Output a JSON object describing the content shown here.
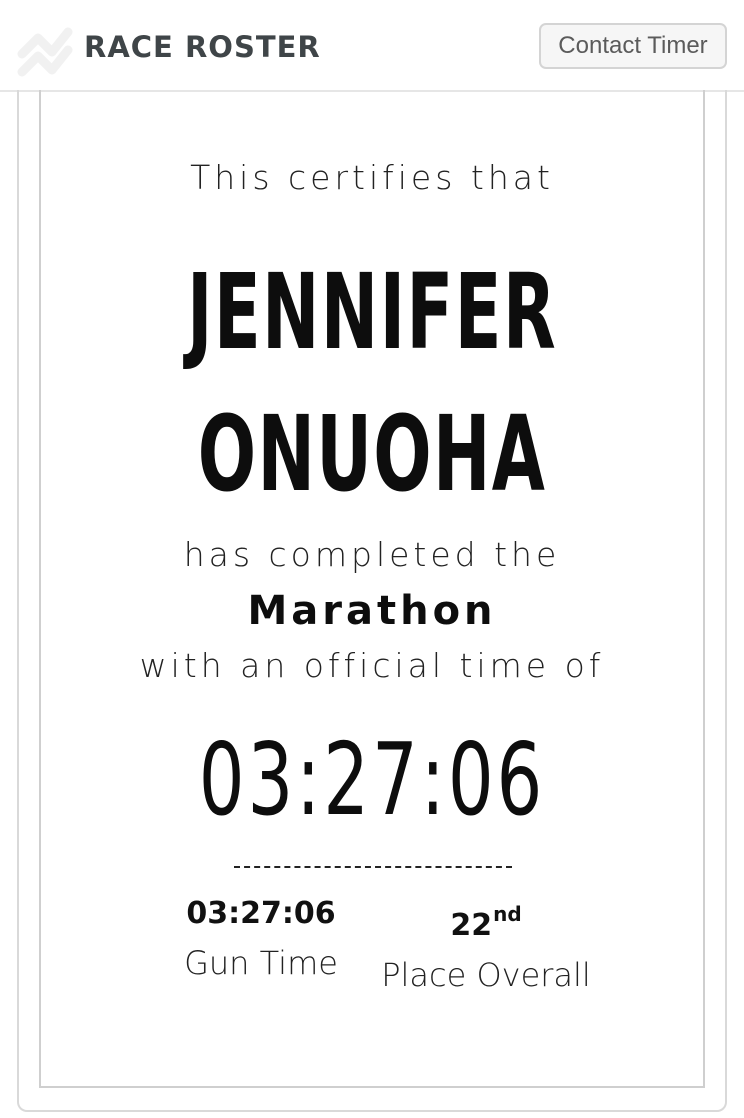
{
  "header": {
    "brand": "RACE ROSTER",
    "contact_button": "Contact Timer"
  },
  "certificate": {
    "intro": "This certifies that",
    "first_name": "JENNIFER",
    "last_name": "ONUOHA",
    "completed_text": "has completed the",
    "event": "Marathon",
    "official_text": "with an official time of",
    "official_time": "03:27:06",
    "gun_time": "03:27:06",
    "gun_time_label": "Gun Time",
    "place_number": "22",
    "place_suffix": "nd",
    "place_label": "Place Overall"
  }
}
